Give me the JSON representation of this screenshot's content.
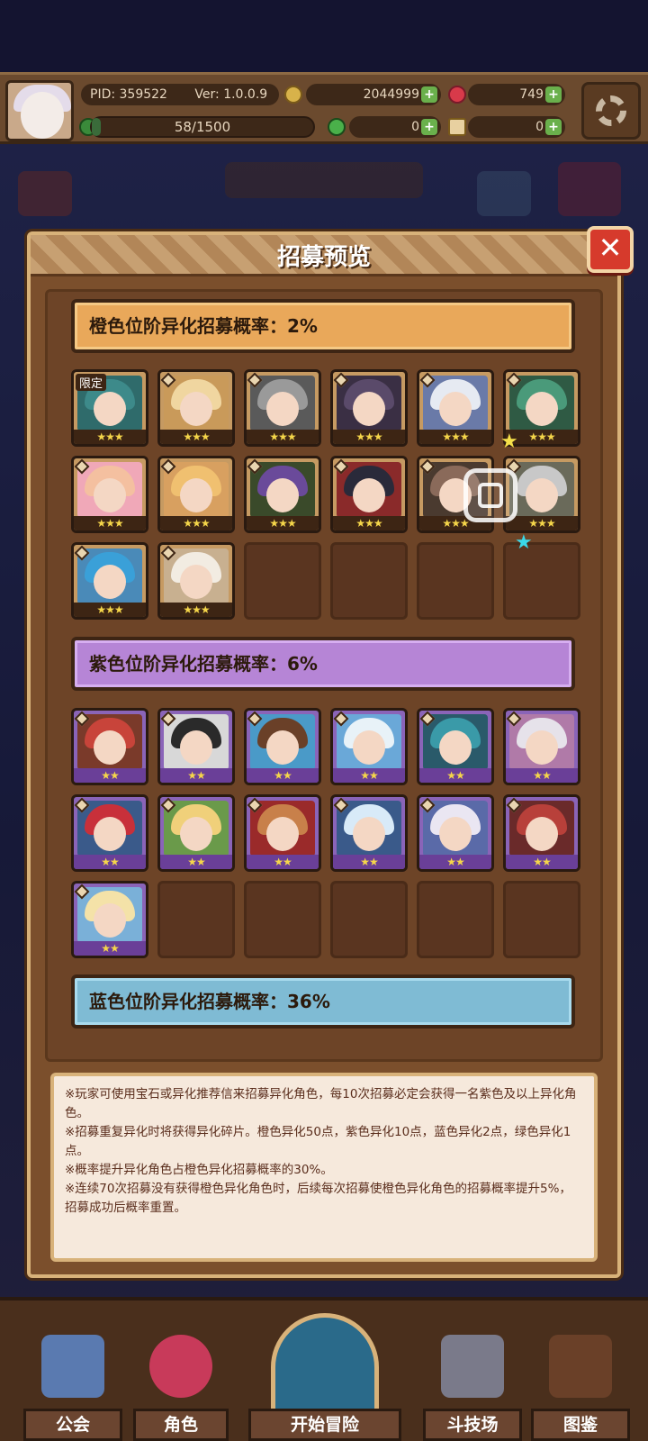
{
  "status_bar": {
    "pid": "PID: 359522",
    "version": "Ver: 1.0.0.9",
    "gold": "2044999",
    "gems": "749",
    "energy": "58/1500",
    "energy_fraction": 0.04,
    "clover": "0",
    "key": "0"
  },
  "modal": {
    "title": "招募预览",
    "close_label": "✕",
    "tiers": [
      {
        "label": "橙色位阶异化招募概率：2%",
        "cards": [
          {
            "stars": "★★★",
            "tag": "限定",
            "hair": "#3d8a8a",
            "bg": "#2f6b6b"
          },
          {
            "stars": "★★★",
            "hair": "#f0d6a0",
            "bg": "#c99a5a"
          },
          {
            "stars": "★★★",
            "hair": "#9a9a9a",
            "bg": "#5a5a5a"
          },
          {
            "stars": "★★★",
            "hair": "#5a4a6a",
            "bg": "#3a2f44"
          },
          {
            "stars": "★★★",
            "hair": "#e6eaf2",
            "bg": "#6a7aa8"
          },
          {
            "stars": "★★★",
            "hair": "#4a9a7a",
            "bg": "#2f5a44"
          },
          {
            "stars": "★★★",
            "hair": "#f4c0a0",
            "bg": "#f0a8b8"
          },
          {
            "stars": "★★★",
            "hair": "#f0c070",
            "bg": "#d8a060"
          },
          {
            "stars": "★★★",
            "hair": "#6a4a9a",
            "bg": "#3a4a2a"
          },
          {
            "stars": "★★★",
            "hair": "#2a2a3a",
            "bg": "#8a2a2a"
          },
          {
            "stars": "★★★",
            "hair": "#8a6a5a",
            "bg": "#4a3a2f"
          },
          {
            "stars": "★★★",
            "hair": "#c8c8c8",
            "bg": "#6a6a5a"
          },
          {
            "stars": "★★★",
            "hair": "#3aa0d8",
            "bg": "#4a8ab8"
          },
          {
            "stars": "★★★",
            "hair": "#f2ece2",
            "bg": "#c8b090"
          }
        ],
        "empty_slots": 4
      },
      {
        "label": "紫色位阶异化招募概率：6%",
        "cards": [
          {
            "stars": "★★",
            "hair": "#c8443a",
            "bg": "#7a3a2a"
          },
          {
            "stars": "★★",
            "hair": "#2a2a2a",
            "bg": "#d8d8d8"
          },
          {
            "stars": "★★",
            "hair": "#6a4028",
            "bg": "#4a9ac8"
          },
          {
            "stars": "★★",
            "hair": "#e8f2f8",
            "bg": "#6aa8d8"
          },
          {
            "stars": "★★",
            "hair": "#3a9aa8",
            "bg": "#2a5a6a"
          },
          {
            "stars": "★★",
            "hair": "#e6e2ea",
            "bg": "#b07aa8"
          },
          {
            "stars": "★★",
            "hair": "#c8303a",
            "bg": "#3a5a8a"
          },
          {
            "stars": "★★",
            "hair": "#f0d07a",
            "bg": "#6a9a4a"
          },
          {
            "stars": "★★",
            "hair": "#c8804a",
            "bg": "#9a2a2a"
          },
          {
            "stars": "★★",
            "hair": "#d8eaf8",
            "bg": "#3a5a8a"
          },
          {
            "stars": "★★",
            "hair": "#eae6f2",
            "bg": "#5a6aa8"
          },
          {
            "stars": "★★",
            "hair": "#b8403a",
            "bg": "#6a2a2a"
          },
          {
            "stars": "★★",
            "hair": "#f4e2a8",
            "bg": "#7ab0d8"
          }
        ],
        "empty_slots": 5
      },
      {
        "label": "蓝色位阶异化招募概率：36%"
      }
    ],
    "notes": [
      "※玩家可使用宝石或异化推荐信来招募异化角色，每10次招募必定会获得一名紫色及以上异化角色。",
      "※招募重复异化时将获得异化碎片。橙色异化50点，紫色异化10点，蓝色异化2点，绿色异化1点。",
      "※概率提升异化角色占橙色异化招募概率的30%。",
      "※连续70次招募没有获得橙色异化角色时，后续每次招募使橙色异化角色的招募概率提升5%，招募成功后概率重置。"
    ]
  },
  "bottom_nav": {
    "items": [
      "公会",
      "角色",
      "开始冒险",
      "斗技场",
      "图鉴"
    ]
  },
  "colors": {
    "orange_tier": "#e9a85a",
    "purple_tier": "#b685d6",
    "blue_tier": "#7fbbd4",
    "close_button": "#d63a2c",
    "star": "#f5d64a"
  },
  "icons": [
    "avatar",
    "gold-coin-icon",
    "gem-icon",
    "clover-icon",
    "key-icon",
    "settings-gear-icon",
    "close-icon",
    "screenshot-float-icon"
  ]
}
